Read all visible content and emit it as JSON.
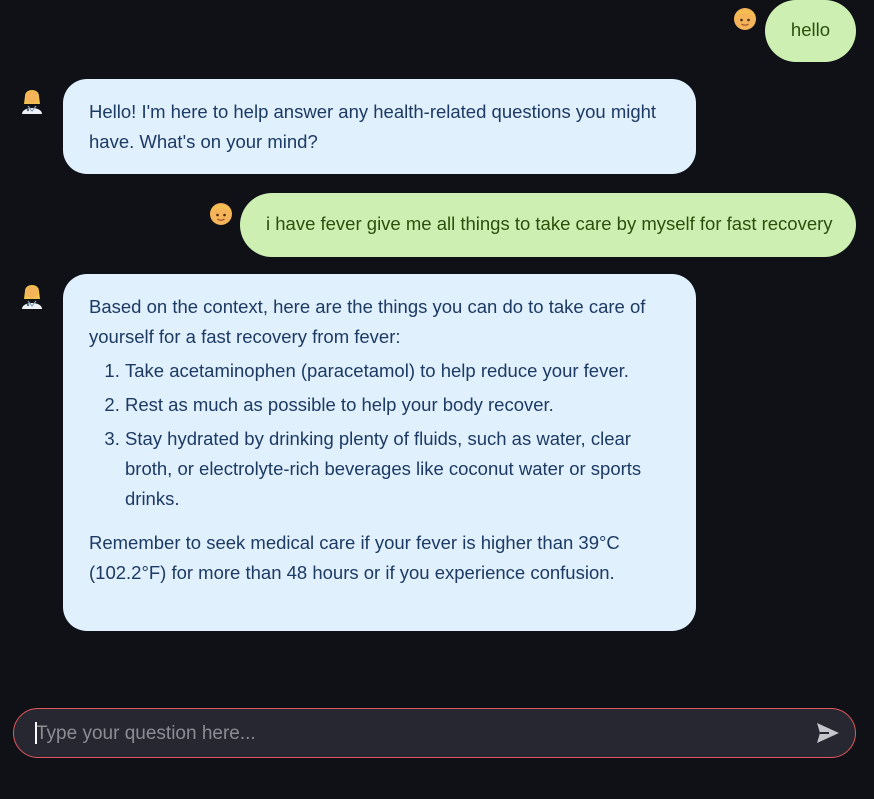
{
  "messages": [
    {
      "role": "user",
      "avatar_icon": "user-face-icon",
      "text": "hello"
    },
    {
      "role": "assistant",
      "avatar_icon": "health-worker-icon",
      "text": "Hello! I'm here to help answer any health-related questions you might have. What's on your mind?"
    },
    {
      "role": "user",
      "avatar_icon": "user-face-icon",
      "text": "i have fever give me all things to take care by myself for fast recovery"
    },
    {
      "role": "assistant",
      "avatar_icon": "health-worker-icon",
      "intro": "Based on the context, here are the things you can do to take care of yourself for a fast recovery from fever:",
      "items": [
        "Take acetaminophen (paracetamol) to help reduce your fever.",
        "Rest as much as possible to help your body recover.",
        "Stay hydrated by drinking plenty of fluids, such as water, clear broth, or electrolyte-rich beverages like coconut water or sports drinks."
      ],
      "outro": "Remember to seek medical care if your fever is higher than 39°C (102.2°F) for more than 48 hours or if you experience confusion."
    }
  ],
  "chat_input": {
    "placeholder": "Type your question here...",
    "value": ""
  },
  "colors": {
    "background": "#0f1117",
    "user_bubble": "#cdf0b2",
    "assistant_bubble": "#e0f0fd",
    "input_border": "#e0575b"
  }
}
